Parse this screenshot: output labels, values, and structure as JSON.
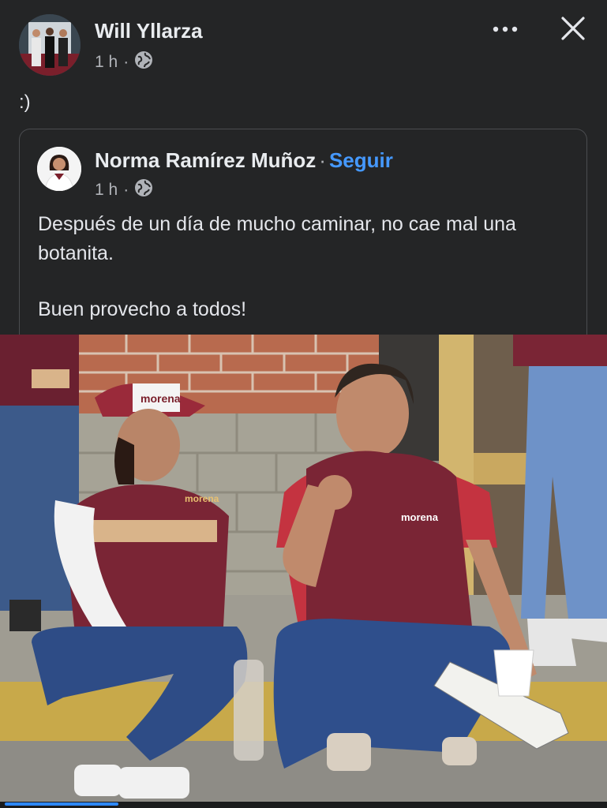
{
  "post": {
    "author": "Will Yllarza",
    "time": "1 h",
    "separator": "·",
    "audience_icon": "globe-icon",
    "text": ":)"
  },
  "header_actions": {
    "more_icon": "more-horizontal-icon",
    "close_icon": "close-icon"
  },
  "shared_post": {
    "author": "Norma Ramírez Muñoz",
    "separator": "·",
    "follow_label": "Seguir",
    "time": "1 h",
    "audience_icon": "globe-icon",
    "body_line1": "Después de un día de mucho caminar, no cae mal una botanita.",
    "body_line2": "Buen provecho a todos!"
  },
  "photo": {
    "cap_text": "morena",
    "vest_text_left": "morena",
    "vest_text_right": "morena"
  },
  "media_progress": 0.19,
  "colors": {
    "background": "#242526",
    "follow_link": "#4599ff",
    "progress": "#2d88ff"
  }
}
